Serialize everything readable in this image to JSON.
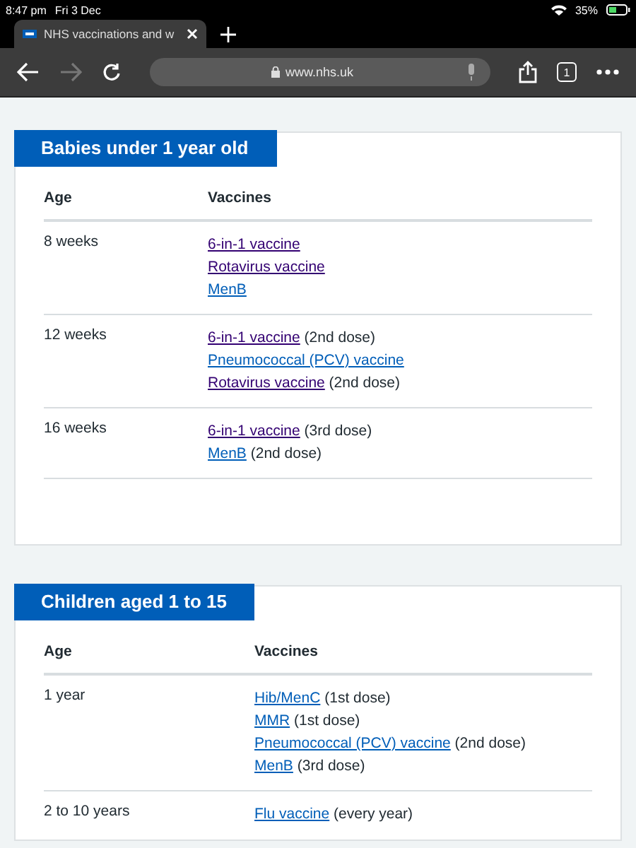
{
  "status_bar": {
    "time": "8:47 pm",
    "date": "Fri 3 Dec",
    "battery": "35%"
  },
  "tabs": [
    {
      "title": "NHS vaccinations and w"
    }
  ],
  "toolbar": {
    "url": "www.nhs.uk",
    "tab_count": "1"
  },
  "sections": [
    {
      "heading": "Babies under 1 year old",
      "columns": [
        "Age",
        "Vaccines"
      ],
      "rows": [
        {
          "age": "8 weeks",
          "vaccines": [
            {
              "link": "6-in-1 vaccine",
              "visited": true
            },
            {
              "link": "Rotavirus vaccine",
              "visited": true
            },
            {
              "link": "MenB",
              "visited": false
            }
          ]
        },
        {
          "age": "12 weeks",
          "vaccines": [
            {
              "link": "6-in-1 vaccine",
              "visited": true,
              "note": "(2nd dose)"
            },
            {
              "link": "Pneumococcal (PCV) vaccine",
              "visited": false
            },
            {
              "link": "Rotavirus vaccine",
              "visited": true,
              "note": "(2nd dose)"
            }
          ]
        },
        {
          "age": "16 weeks",
          "vaccines": [
            {
              "link": "6-in-1 vaccine",
              "visited": true,
              "note": "(3rd dose)"
            },
            {
              "link": "MenB",
              "visited": false,
              "note": "(2nd dose)"
            }
          ]
        }
      ]
    },
    {
      "heading": "Children aged 1 to 15",
      "columns": [
        "Age",
        "Vaccines"
      ],
      "rows": [
        {
          "age": "1 year",
          "vaccines": [
            {
              "link": "Hib/MenC",
              "visited": false,
              "note": "(1st dose)"
            },
            {
              "link": "MMR",
              "visited": false,
              "note": "(1st dose)"
            },
            {
              "link": "Pneumococcal (PCV) vaccine",
              "visited": false,
              "note": "(2nd dose)"
            },
            {
              "link": "MenB",
              "visited": false,
              "note": "(3rd dose)"
            }
          ]
        },
        {
          "age": "2 to 10 years",
          "vaccines": [
            {
              "link": "Flu vaccine",
              "visited": false,
              "note": "(every year)"
            }
          ]
        }
      ]
    }
  ]
}
